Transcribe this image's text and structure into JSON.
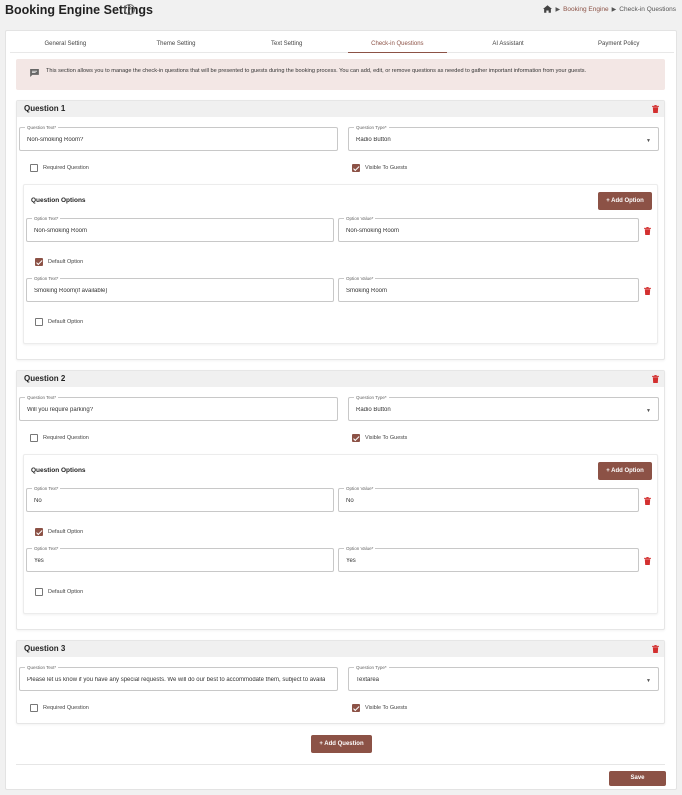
{
  "header": {
    "title": "Booking Engine Settings",
    "help_icon": "question-circle-icon",
    "breadcrumb": {
      "home_icon": "home-icon",
      "link": "Booking Engine",
      "current": "Check-in Questions"
    }
  },
  "tabs": [
    {
      "label": "General Setting",
      "active": false
    },
    {
      "label": "Theme Setting",
      "active": false
    },
    {
      "label": "Text Setting",
      "active": false
    },
    {
      "label": "Check-in Questions",
      "active": true
    },
    {
      "label": "AI Assistant",
      "active": false
    },
    {
      "label": "Payment Policy",
      "active": false
    }
  ],
  "info": {
    "icon": "message-icon",
    "text": "This section allows you to manage the check-in questions that will be presented to guests during the booking process. You can add, edit, or remove questions as needed to gather important information from your guests."
  },
  "labels": {
    "question_text": "Question Text*",
    "question_type": "Question Type*",
    "required": "Required Question",
    "visible": "Visible To Guests",
    "question_options": "Question Options",
    "add_option": "+ Add Option",
    "option_text": "Option Text*",
    "option_value": "Option Value*",
    "default_option": "Default Option",
    "add_question": "+ Add Question",
    "save": "Save"
  },
  "questions": [
    {
      "title": "Question 1",
      "text": "Non-smoking Room?",
      "type": "Radio Button",
      "required": false,
      "visible": true,
      "options": [
        {
          "text": "Non-smoking Room",
          "value": "Non-smoking Room",
          "default": true
        },
        {
          "text": "Smoking Room(if available)",
          "value": "Smoking Room",
          "default": false
        }
      ]
    },
    {
      "title": "Question 2",
      "text": "Will you require parking?",
      "type": "Radio Button",
      "required": false,
      "visible": true,
      "options": [
        {
          "text": "No",
          "value": "No",
          "default": true
        },
        {
          "text": "Yes",
          "value": "Yes",
          "default": false
        }
      ]
    },
    {
      "title": "Question 3",
      "text": "Please let us know if you have any special requests. We will do our best to accommodate them, subject to availability.",
      "type": "Textarea",
      "required": false,
      "visible": true
    }
  ],
  "colors": {
    "accent": "#8c5246",
    "delete": "#d32f2f",
    "info_bg": "#f3e7e5"
  }
}
